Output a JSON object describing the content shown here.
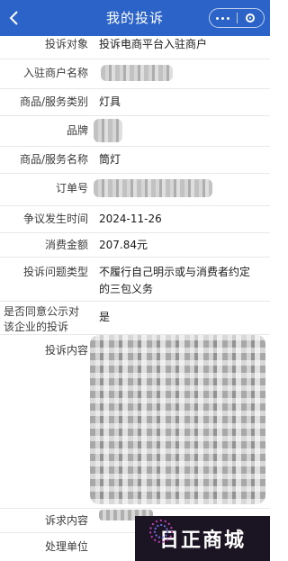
{
  "nav": {
    "title": "我的投诉"
  },
  "fields": [
    {
      "label": "投诉对象",
      "value": "投诉电商平台入驻商户"
    },
    {
      "label": "入驻商户名称",
      "value": ""
    },
    {
      "label": "商品/服务类别",
      "value": "灯具"
    },
    {
      "label": "品牌",
      "value": ""
    },
    {
      "label": "商品/服务名称",
      "value": "筒灯"
    },
    {
      "label": "订单号",
      "value": ""
    },
    {
      "label": "争议发生时间",
      "value": "2024-11-26"
    },
    {
      "label": "消费金额",
      "value": "207.84元"
    },
    {
      "label": "投诉问题类型",
      "value": "不履行自己明示或与消费者约定的三包义务"
    },
    {
      "label_line1": "是否同意公示对",
      "label_line2": "该企业的投诉",
      "value": "是"
    },
    {
      "label": "投诉内容",
      "value": ""
    },
    {
      "label": "诉求内容",
      "value": ""
    },
    {
      "label": "处理单位",
      "value": ""
    }
  ],
  "watermark": {
    "text": "日正商城"
  },
  "icons": {
    "back": "back-arrow-icon",
    "more": "more-dots-icon",
    "close": "close-ring-icon"
  },
  "colors": {
    "nav_bg": "#2b63c9",
    "divider": "#e8e8e8"
  }
}
